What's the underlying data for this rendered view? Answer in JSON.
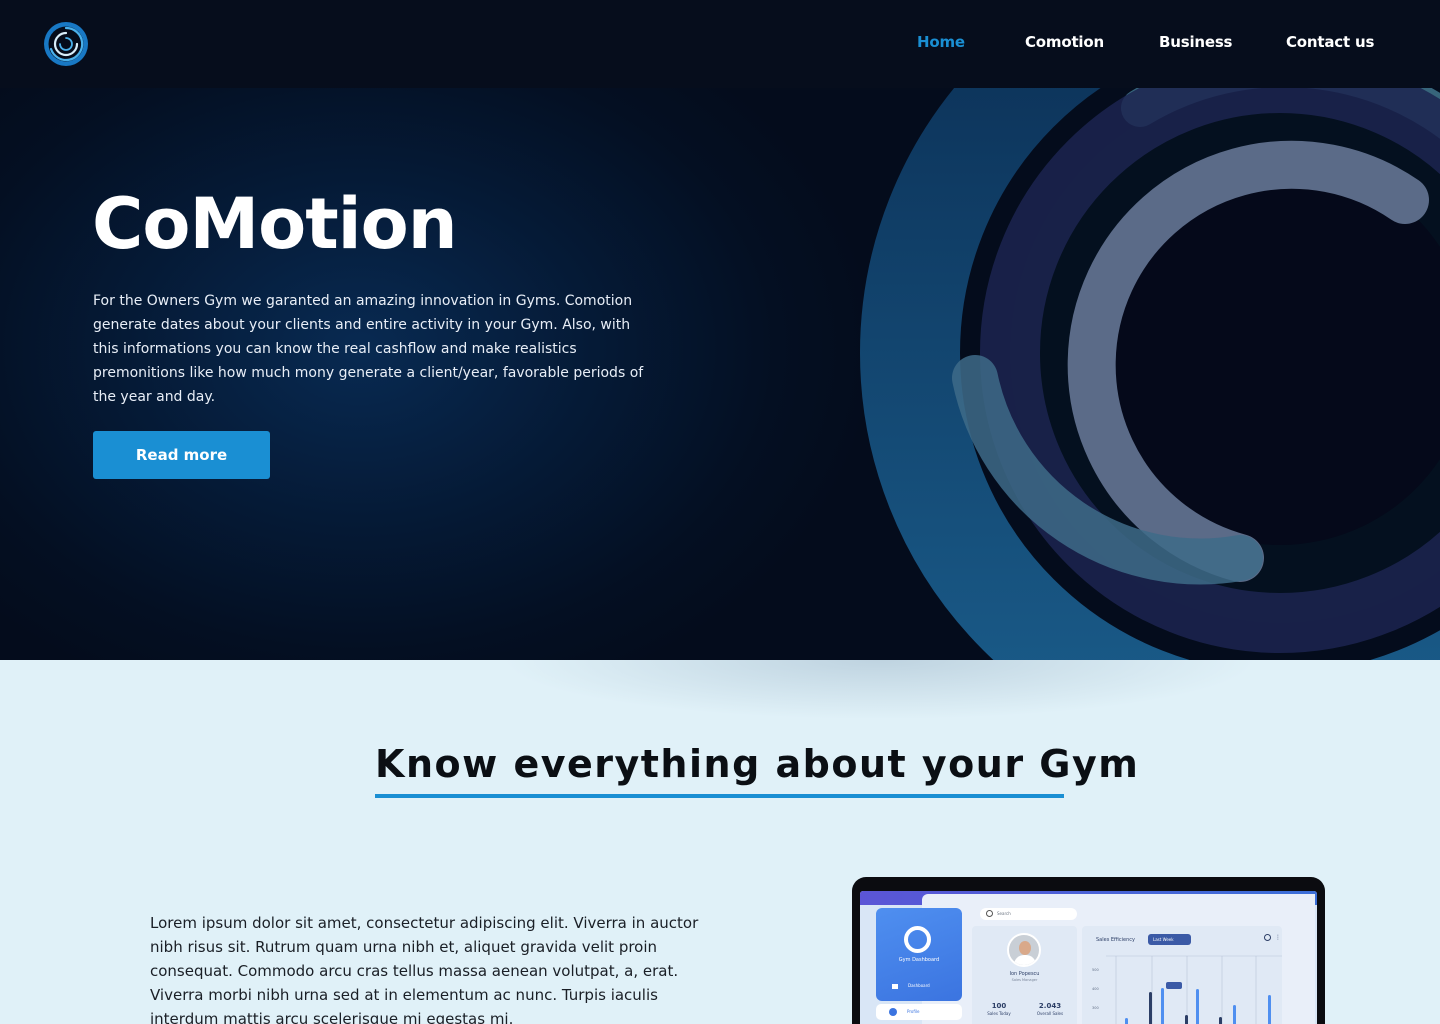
{
  "nav": {
    "links": [
      {
        "label": "Home",
        "active": true
      },
      {
        "label": "Comotion",
        "active": false
      },
      {
        "label": "Business",
        "active": false
      },
      {
        "label": "Contact us",
        "active": false
      }
    ]
  },
  "hero": {
    "title": "CoMotion",
    "description": "For the Owners Gym we garanted an amazing innovation in Gyms. Comotion generate dates about your clients and entire activity in your Gym. Also, with this informations you can know the real cashflow and make realistics premonitions like how much mony generate a client/year, favorable periods of the year and day.",
    "cta_label": "Read more"
  },
  "section": {
    "title": "Know everything about your Gym",
    "body": "Lorem ipsum dolor sit amet, consectetur adipiscing elit. Viverra in auctor nibh risus sit. Rutrum quam urna nibh et, aliquet gravida velit proin consequat. Commodo arcu cras tellus massa aenean volutpat, a, erat. Viverra morbi nibh urna sed at in elementum ac nunc. Turpis iaculis interdum mattis arcu scelerisque mi egestas mi."
  },
  "dashboard": {
    "sidebar_title": "Gym Dashboard",
    "nav_dashboard": "Dashboard",
    "nav_profile": "Profile",
    "search_placeholder": "Search",
    "profile_name": "Ion Popescu",
    "profile_role": "Sales Manager",
    "stats": [
      {
        "value": "100",
        "label": "Sales Today"
      },
      {
        "value": "2.043",
        "label": "Overall Sales"
      }
    ],
    "chart_title": "Sales Efficiency",
    "chart_filter": "Last Week",
    "chart_y_ticks": [
      "500",
      "400",
      "300"
    ]
  },
  "colors": {
    "accent": "#1a8fd3",
    "nav_bg": "#060d1c",
    "section_bg": "#e0f1f8"
  }
}
